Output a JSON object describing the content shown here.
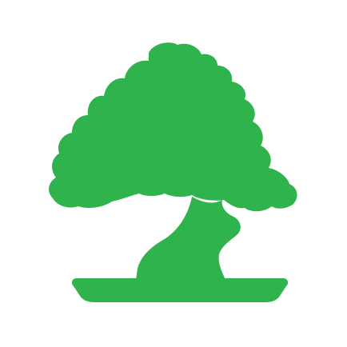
{
  "image": {
    "background_color": "#ffffff",
    "icon_name": "bonsai-tree-icon",
    "icon_color": "#2eb34d"
  }
}
